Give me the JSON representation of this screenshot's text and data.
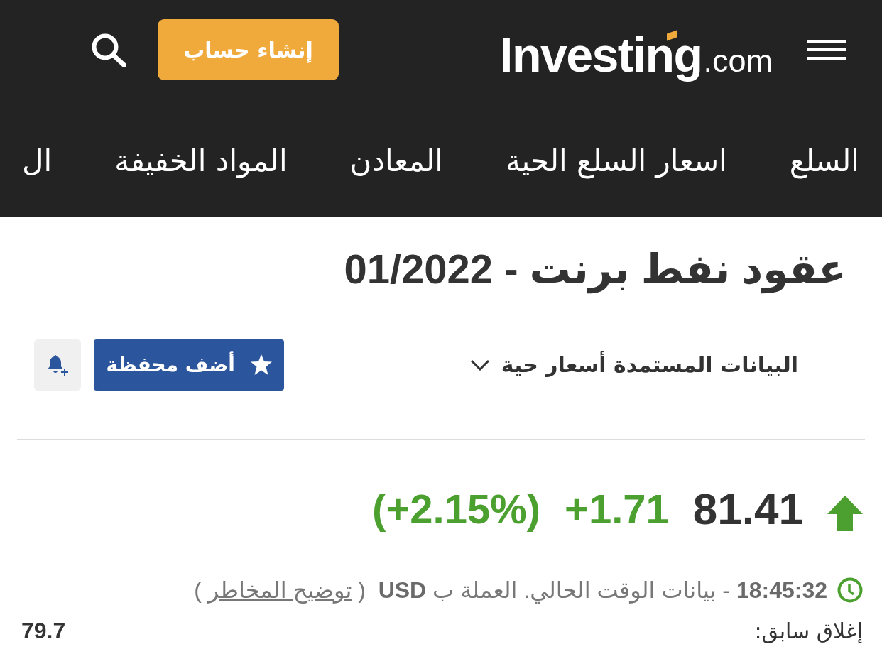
{
  "header": {
    "logo": {
      "name": "Investing",
      "suffix": ".com"
    },
    "signup_button": "إنشاء حساب"
  },
  "nav": {
    "items": [
      "السلع",
      "اسعار السلع الحية",
      "المعادن",
      "المواد الخفيفة",
      "ال"
    ]
  },
  "instrument": {
    "title": "عقود نفط برنت - 01/2022",
    "data_source": "البيانات المستمدة أسعار حية",
    "portfolio_button": "أضف محفظة"
  },
  "quote": {
    "rising": true,
    "last": "81.41",
    "change": "+1.71",
    "change_percent": "(+2.15%)"
  },
  "notice": {
    "text": "**18:45:32** - بيانات الوقت الحالي.  العملة ب **USD**",
    "open": "(",
    "link": "توضيح المخاطر",
    "close": ")"
  },
  "previous_close": {
    "label": "إغلاق سابق:",
    "value": "79.7"
  }
}
